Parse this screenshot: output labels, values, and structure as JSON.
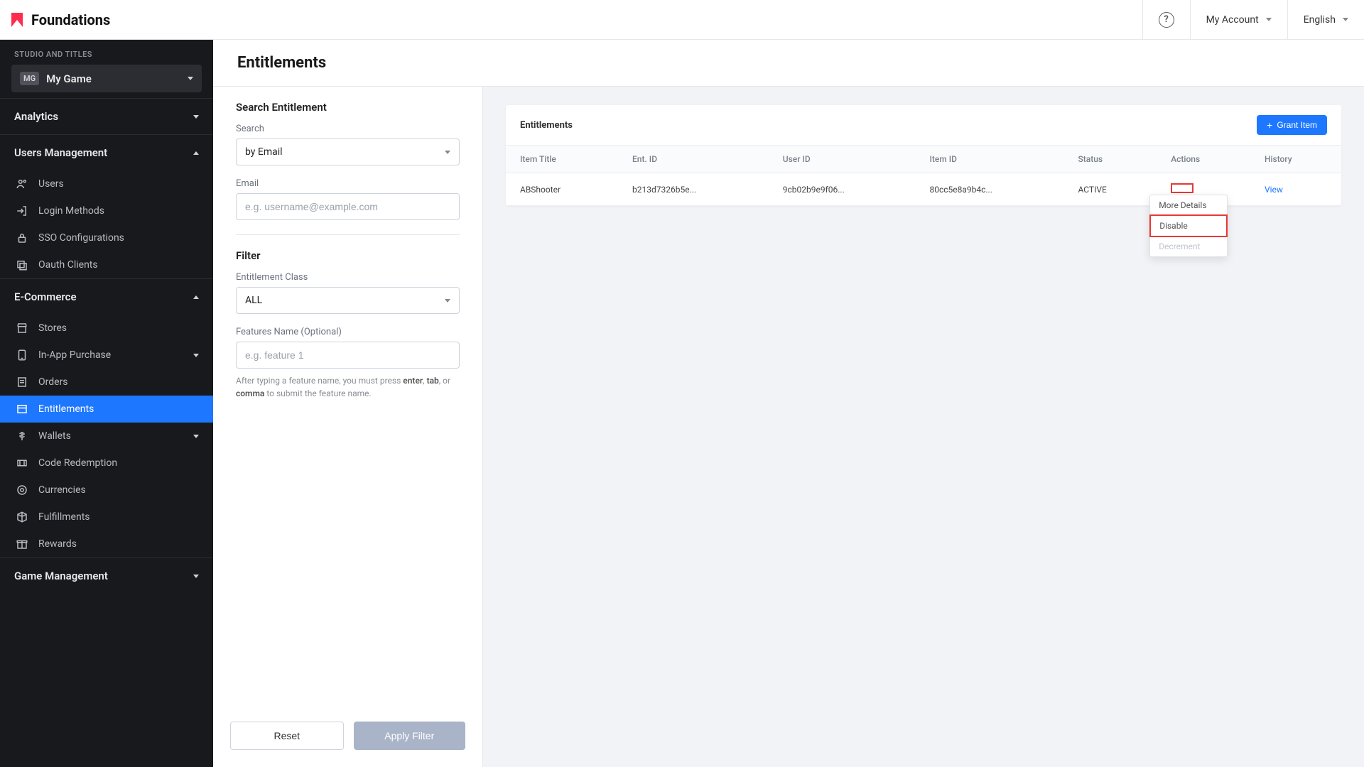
{
  "brand": "Foundations",
  "header": {
    "my_account": "My Account",
    "language": "English"
  },
  "sidebar": {
    "section_label": "STUDIO AND TITLES",
    "game_badge": "MG",
    "game_name": "My Game",
    "analytics": "Analytics",
    "users_mgmt": "Users Management",
    "users_items": {
      "users": "Users",
      "login_methods": "Login Methods",
      "sso": "SSO Configurations",
      "oauth": "Oauth Clients"
    },
    "ecommerce": "E-Commerce",
    "ecom_items": {
      "stores": "Stores",
      "iap": "In-App Purchase",
      "orders": "Orders",
      "entitlements": "Entitlements",
      "wallets": "Wallets",
      "code_redemption": "Code Redemption",
      "currencies": "Currencies",
      "fulfillments": "Fulfillments",
      "rewards": "Rewards"
    },
    "game_mgmt": "Game Management"
  },
  "page": {
    "title": "Entitlements"
  },
  "filter": {
    "search_title": "Search Entitlement",
    "search_label": "Search",
    "search_by": "by Email",
    "email_label": "Email",
    "email_placeholder": "e.g. username@example.com",
    "filter_title": "Filter",
    "class_label": "Entitlement Class",
    "class_value": "ALL",
    "features_label": "Features Name (Optional)",
    "features_placeholder": "e.g. feature 1",
    "helper_pre": "After typing a feature name, you must press ",
    "helper_b1": "enter",
    "helper_mid1": ", ",
    "helper_b2": "tab",
    "helper_mid2": ", or ",
    "helper_b3": "comma",
    "helper_post": " to submit the feature name.",
    "reset": "Reset",
    "apply": "Apply Filter"
  },
  "table": {
    "card_title": "Entitlements",
    "grant_btn": "Grant Item",
    "columns": {
      "item_title": "Item Title",
      "ent_id": "Ent. ID",
      "user_id": "User ID",
      "item_id": "Item ID",
      "status": "Status",
      "actions": "Actions",
      "history": "History"
    },
    "rows": [
      {
        "item_title": "ABShooter",
        "ent_id": "b213d7326b5e...",
        "user_id": "9cb02b9e9f06...",
        "item_id": "80cc5e8a9b4c...",
        "status": "ACTIVE",
        "history": "View"
      }
    ],
    "dropdown": {
      "more": "More Details",
      "disable": "Disable",
      "decrement": "Decrement"
    }
  }
}
